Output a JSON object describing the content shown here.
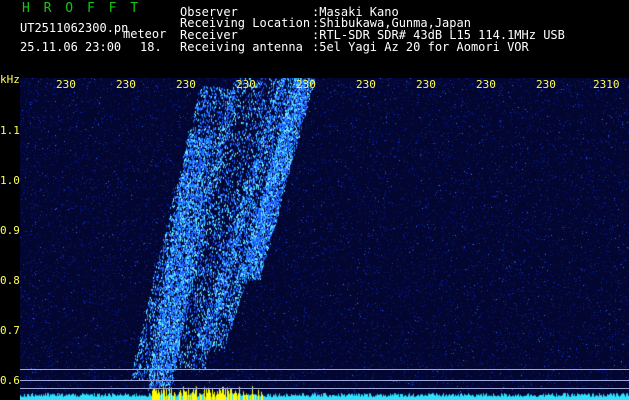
{
  "header": {
    "program": "H R O F F T",
    "filename": "UT2511062300.pn",
    "event_type": "meteor",
    "datetime": "25.11.06 23:00",
    "count": "18.",
    "fields": [
      {
        "label": "Observer",
        "value": ":Masaki Kano"
      },
      {
        "label": "Receiving Location",
        "value": ":Shibukawa,Gunma,Japan"
      },
      {
        "label": "Receiver",
        "value": ":RTL-SDR SDR# 43dB L15 114.1MHz USB"
      },
      {
        "label": "Receiving antenna",
        "value": ":5el Yagi Az 20 for Aomori VOR"
      }
    ]
  },
  "axes": {
    "y_unit": "kHz",
    "y_ticks": [
      "1.1",
      "1.0",
      "0.9",
      "0.8",
      "0.7",
      "0.6"
    ],
    "x_ticks": [
      "230",
      "230",
      "230",
      "230",
      "230",
      "230",
      "230",
      "230",
      "230",
      "2310"
    ]
  },
  "colors": {
    "background": "#000000",
    "plot_noise": "#0a1a8a",
    "echo": "#3fd0ff",
    "baseline": "#2fe0ff",
    "baseline_peak": "#ffff00",
    "labels": "#ffff55",
    "title": "#19c419"
  }
}
